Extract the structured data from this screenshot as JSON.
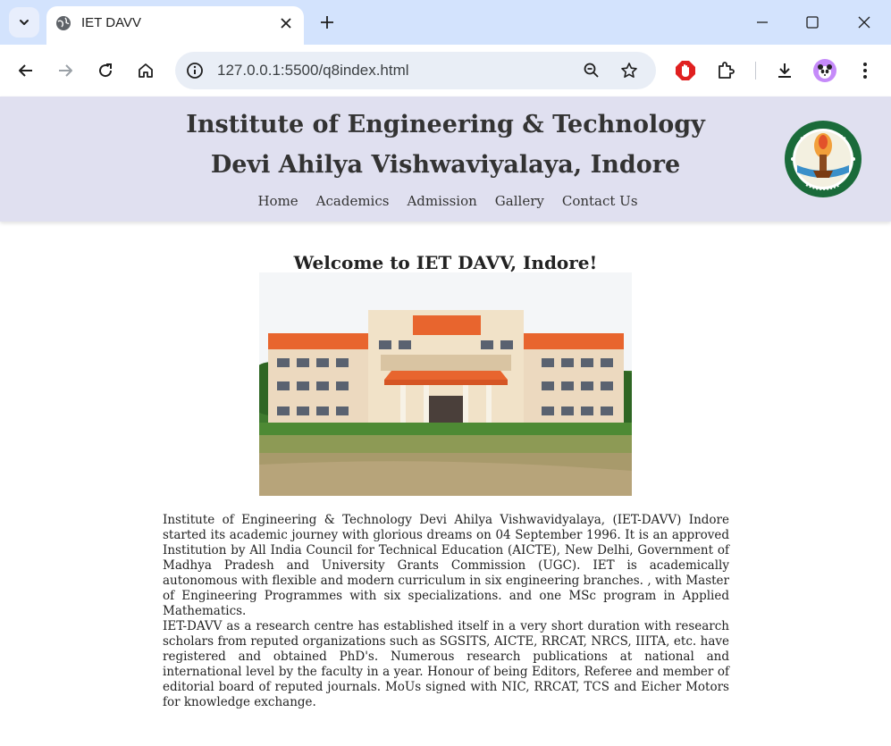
{
  "browser": {
    "tab_title": "IET DAVV",
    "url": "127.0.0.1:5500/q8index.html"
  },
  "header": {
    "title_line1": "Institute of Engineering & Technology",
    "title_line2": "Devi Ahilya Vishwaviyalaya, Indore",
    "nav": [
      "Home",
      "Academics",
      "Admission",
      "Gallery",
      "Contact Us"
    ]
  },
  "main": {
    "welcome": "Welcome to IET DAVV, Indore!",
    "paragraph1": "Institute of Engineering & Technology Devi Ahilya Vishwavidyalaya, (IET-DAVV) Indore started its academic journey with glorious dreams on 04 September 1996. It is an approved Institution by All India Council for Technical Education (AICTE), New Delhi, Government of Madhya Pradesh and University Grants Commission (UGC). IET is academically autonomous with flexible and modern curriculum in six engineering branches. , with Master of Engineering Programmes with six specializations. and one MSc program in Applied Mathematics.",
    "paragraph2": "IET-DAVV as a research centre has established itself in a very short duration with research scholars from reputed organizations such as SGSITS, AICTE, RRCAT, NRCS, IIITA, etc. have registered and obtained PhD's. Numerous research publications at national and international level by the faculty in a year. Honour of being Editors, Referee and member of editorial board of reputed journals. MoUs signed with NIC, RRCAT, TCS and Eicher Motors for knowledge exchange."
  },
  "colors": {
    "header_bg": "#e0e0f0",
    "chrome_bg": "#d3e3fd"
  },
  "icons": [
    "tab-search-icon",
    "globe-icon",
    "close-icon",
    "plus-icon",
    "minimize-icon",
    "maximize-icon",
    "back-icon",
    "forward-icon",
    "reload-icon",
    "home-icon",
    "info-icon",
    "zoom-icon",
    "star-icon",
    "adblock-icon",
    "extensions-icon",
    "download-icon",
    "menu-icon"
  ]
}
